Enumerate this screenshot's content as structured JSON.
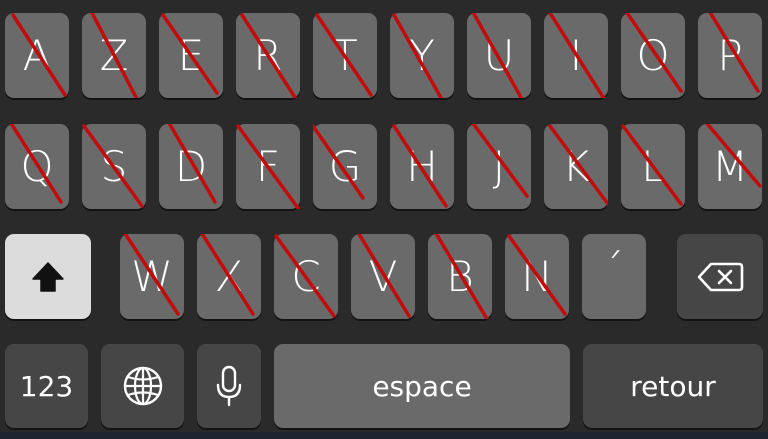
{
  "keyboard": {
    "row1": [
      "A",
      "Z",
      "E",
      "R",
      "T",
      "Y",
      "U",
      "I",
      "O",
      "P"
    ],
    "row2": [
      "Q",
      "S",
      "D",
      "F",
      "G",
      "H",
      "J",
      "K",
      "L",
      "M"
    ],
    "row3": [
      "W",
      "X",
      "C",
      "V",
      "B",
      "N",
      "´"
    ],
    "numbers_label": "123",
    "space_label": "espace",
    "return_label": "retour",
    "icons": {
      "shift": "shift-arrow-icon",
      "delete": "backspace-icon",
      "globe": "globe-icon",
      "mic": "microphone-icon"
    },
    "crossed_out_keys": [
      "A",
      "Z",
      "E",
      "R",
      "T",
      "Y",
      "U",
      "I",
      "O",
      "P",
      "Q",
      "S",
      "D",
      "F",
      "G",
      "H",
      "J",
      "K",
      "L",
      "M",
      "W",
      "X",
      "C",
      "V",
      "B",
      "N"
    ],
    "colors": {
      "background": "#2a2a2a",
      "letter_key": "#6a6a6a",
      "function_key": "#464646",
      "shift_active": "#dcdcdc",
      "strike_mark": "#c40a0a"
    }
  }
}
